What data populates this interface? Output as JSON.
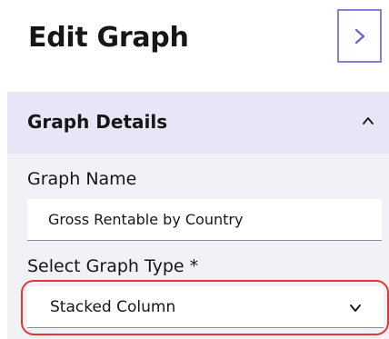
{
  "header": {
    "title": "Edit Graph",
    "expand_icon": "chevron-right-icon"
  },
  "panel": {
    "title": "Graph Details",
    "collapse_icon": "chevron-up-icon",
    "graph_name": {
      "label": "Graph Name",
      "value": "Gross Rentable by Country"
    },
    "graph_type": {
      "label": "Select Graph Type *",
      "selected": "Stacked Column",
      "icon": "chevron-down-icon"
    }
  },
  "colors": {
    "accent": "#8a7fd6",
    "panel_bg": "#f2f1f8",
    "panel_header_bg": "#e8e6f6",
    "highlight": "#e03a2e"
  }
}
